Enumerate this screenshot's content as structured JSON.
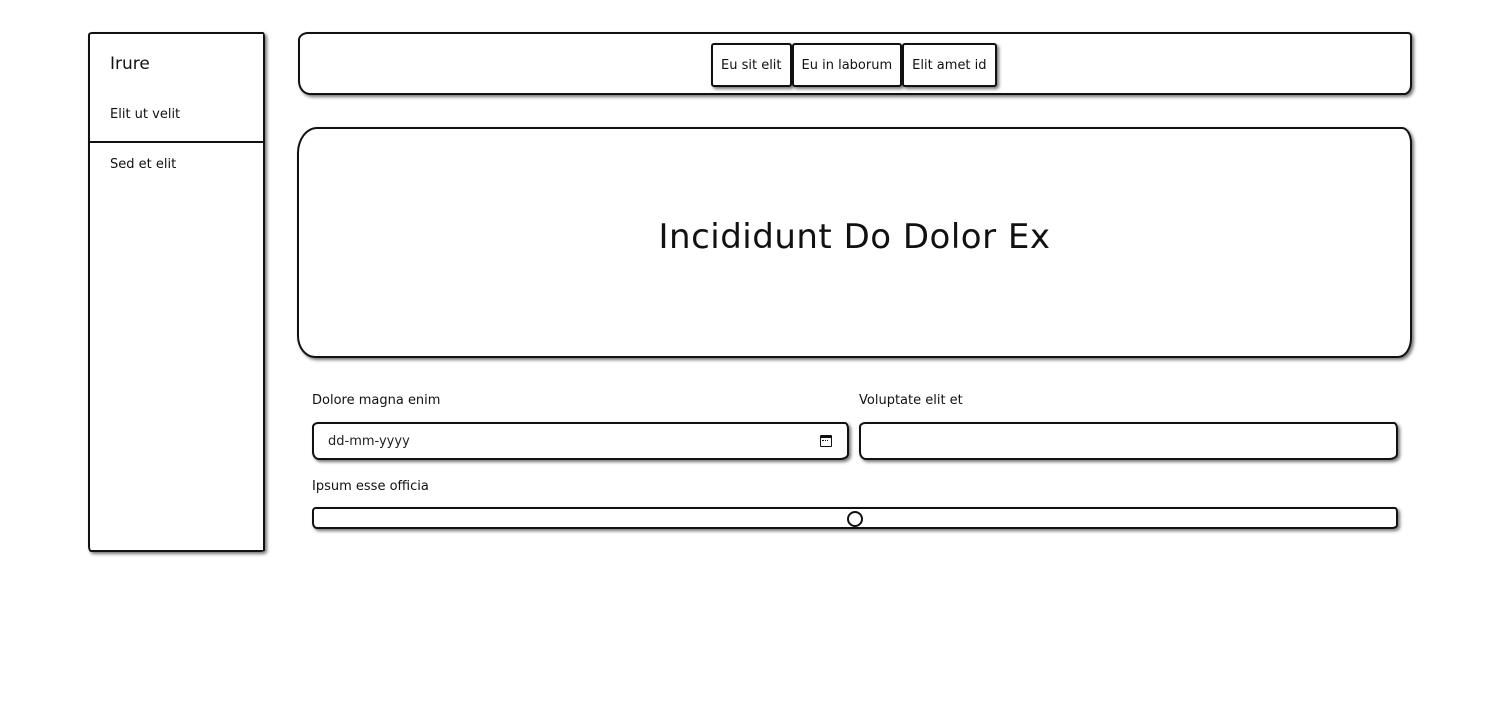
{
  "sidebar": {
    "brand": "Irure",
    "items": [
      {
        "label": "Elit ut velit"
      },
      {
        "label": "Sed et elit"
      }
    ]
  },
  "topbar": {
    "tabs": [
      {
        "label": "Eu sit elit"
      },
      {
        "label": "Eu in laborum"
      },
      {
        "label": "Elit amet id"
      }
    ]
  },
  "hero": {
    "title": "Incididunt Do Dolor Ex"
  },
  "form": {
    "date_label": "Dolore magna enim",
    "date_placeholder": "dd-mm-yyyy",
    "text_label": "Voluptate elit et",
    "text_value": "",
    "range_label": "Ipsum esse officia",
    "range_value": 0.5
  },
  "icons": {
    "date_picker": "calendar-icon"
  }
}
